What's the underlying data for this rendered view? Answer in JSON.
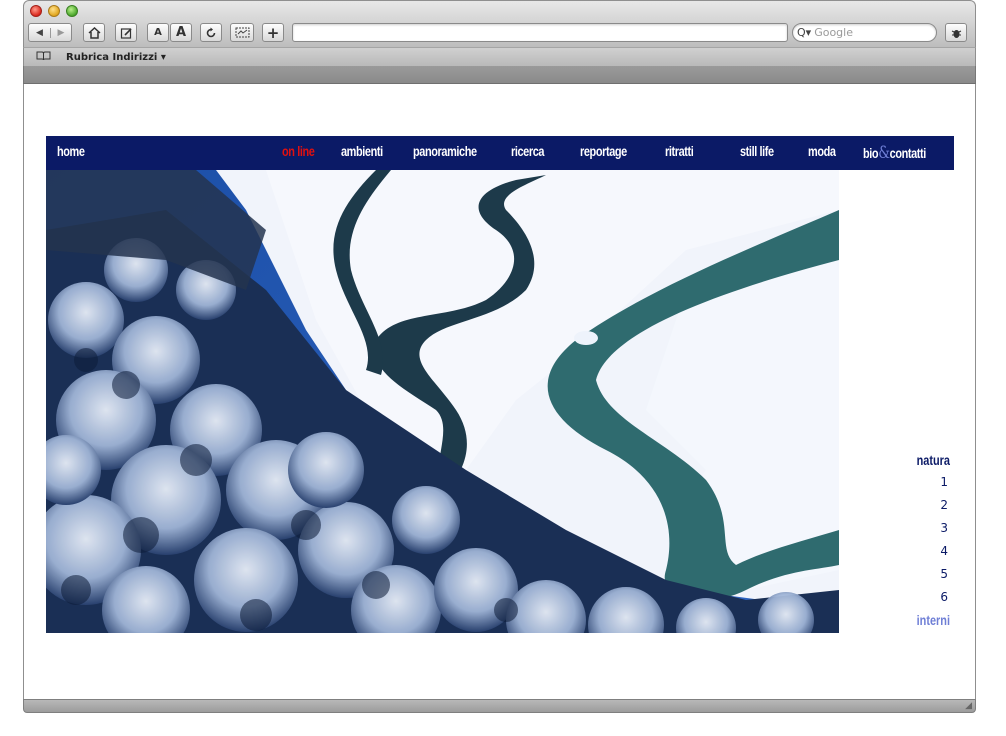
{
  "browser": {
    "toolbar": {
      "back_icon": "back-arrow-icon",
      "forward_icon": "forward-arrow-icon",
      "home_icon": "home-icon",
      "edit_icon": "pencil-icon",
      "font_smaller": "A",
      "font_larger": "A",
      "reload_icon": "reload-icon",
      "snippet_icon": "web-clip-icon",
      "add_icon": "+",
      "url": "",
      "search_placeholder": "Google",
      "bug_icon": "bug-icon"
    },
    "bookmarks_bar": {
      "book_icon": "book-icon",
      "item": "Rubrica Indirizzi ▾"
    }
  },
  "site": {
    "nav": [
      {
        "label": "home"
      },
      {
        "label": "on line",
        "active": true
      },
      {
        "label": "ambienti"
      },
      {
        "label": "panoramiche"
      },
      {
        "label": "ricerca"
      },
      {
        "label": "reportage"
      },
      {
        "label": "ritratti"
      },
      {
        "label": "still life"
      },
      {
        "label": "moda"
      }
    ],
    "bio": {
      "before": "bio",
      "amp": "&",
      "after": "contatti"
    },
    "gallery": {
      "title": "natura",
      "numbers": [
        "1",
        "2",
        "3",
        "4",
        "5",
        "6"
      ],
      "next": "interni"
    },
    "colors": {
      "nav_bg": "#0b1a66",
      "nav_text": "#ffffff",
      "nav_active": "#e01010",
      "accent_light": "#6f7fd6"
    }
  }
}
